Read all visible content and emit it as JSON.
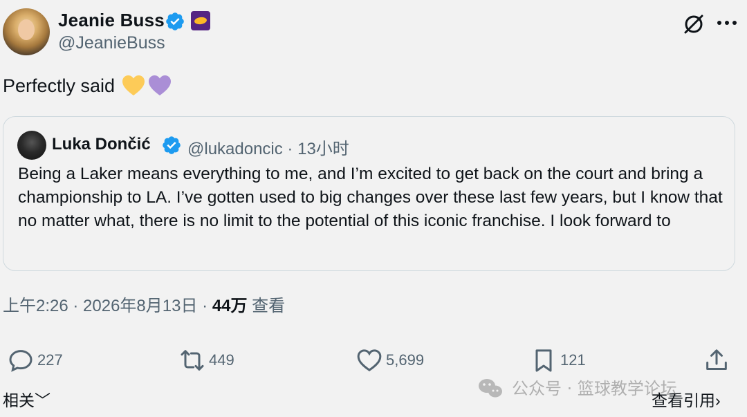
{
  "author": {
    "display_name": "Jeanie Buss",
    "handle": "@JeanieBuss"
  },
  "tweet": {
    "text": "Perfectly said",
    "emojis": [
      "yellow-heart",
      "purple-heart"
    ],
    "timestamp": "上午2:26 · 2026年8月13日 · ",
    "views_count": "44万",
    "views_label": " 查看"
  },
  "quoted": {
    "display_name": "Luka Dončić",
    "meta": "@lukadoncic · 13小时",
    "text": "Being a Laker means everything to me, and I’m excited to get back on the court and bring a championship to LA. I’ve gotten used to big changes over these last few years, but I know that no matter what, there is no limit to the potential of this iconic franchise. I look forward to"
  },
  "actions": {
    "replies": "227",
    "reposts": "449",
    "likes": "5,699",
    "bookmarks": "121"
  },
  "footer": {
    "related": "相关",
    "view_quotes": "查看引用"
  },
  "watermark": "公众号 · 篮球教学论坛",
  "colors": {
    "background": "#f2f2f2",
    "verified_blue": "#1d9bf0",
    "lakers_purple": "#552583",
    "lakers_gold": "#fdb927",
    "secondary_text": "#536471"
  }
}
